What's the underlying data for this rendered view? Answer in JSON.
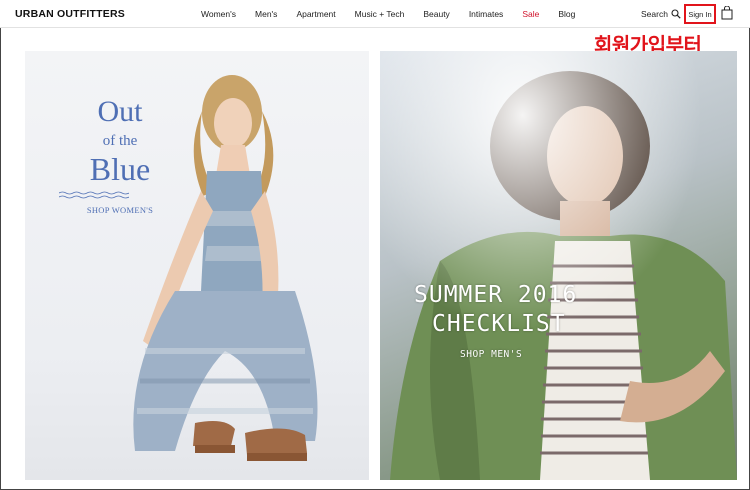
{
  "header": {
    "logo": "URBAN OUTFITTERS",
    "nav": [
      "Women's",
      "Men's",
      "Apartment",
      "Music + Tech",
      "Beauty",
      "Intimates",
      "Sale",
      "Blog"
    ],
    "search_label": "Search",
    "signin_label": "Sign In"
  },
  "annotation": {
    "text": "회원가입부터"
  },
  "promo_left": {
    "title_line1": "Out",
    "title_line2": "of the",
    "title_line3": "Blue",
    "cta": "SHOP WOMEN'S"
  },
  "promo_right": {
    "title_line1": "SUMMER 2016",
    "title_line2": "CHECKLIST",
    "cta": "SHOP MEN'S"
  },
  "colors": {
    "sale": "#d0142c",
    "highlight": "#e1141b",
    "promo_blue": "#4f6fb4"
  }
}
